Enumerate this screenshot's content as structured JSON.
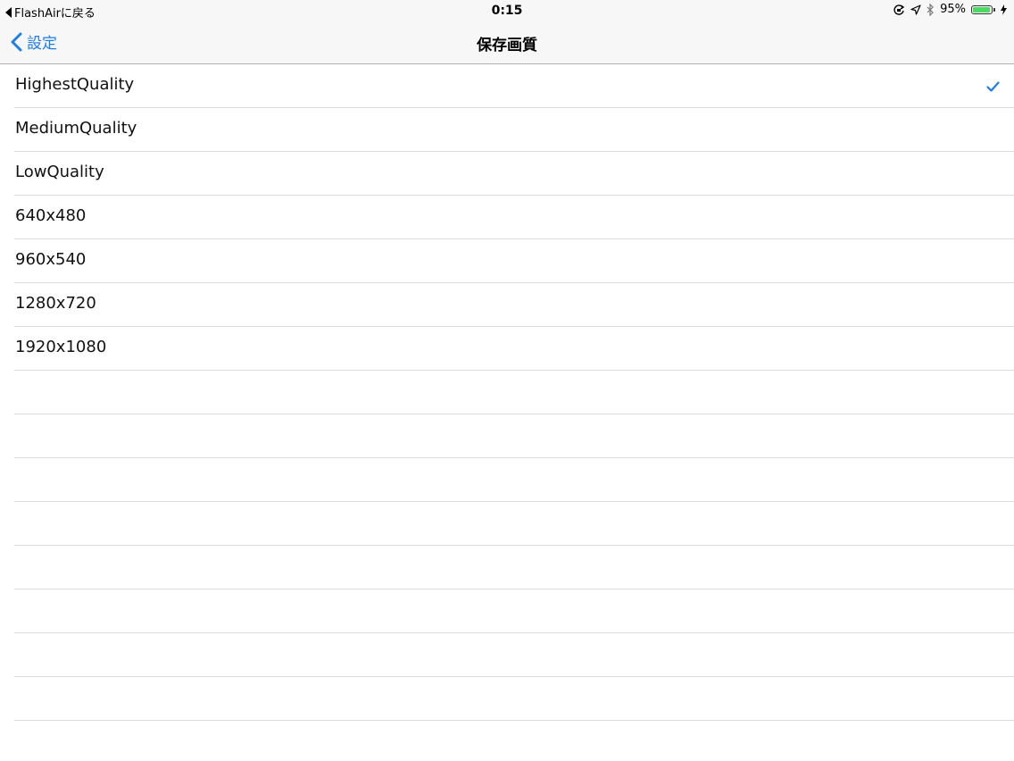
{
  "status_bar": {
    "back_app": "FlashAirに戻る",
    "time": "0:15",
    "battery_percent": "95%",
    "battery_level": 0.95,
    "icons": [
      "rotation-lock-icon",
      "location-arrow-icon",
      "bluetooth-icon",
      "battery-icon",
      "charging-bolt-icon"
    ]
  },
  "nav": {
    "back_label": "設定",
    "title": "保存画質"
  },
  "options": [
    {
      "label": "HighestQuality",
      "selected": true
    },
    {
      "label": "MediumQuality",
      "selected": false
    },
    {
      "label": "LowQuality",
      "selected": false
    },
    {
      "label": "640x480",
      "selected": false
    },
    {
      "label": "960x540",
      "selected": false
    },
    {
      "label": "1280x720",
      "selected": false
    },
    {
      "label": "1920x1080",
      "selected": false
    }
  ],
  "colors": {
    "accent": "#1f7ee4",
    "separator": "#dcdcdc",
    "bar_background": "#f7f7f7",
    "battery_fill": "#4cd964"
  }
}
